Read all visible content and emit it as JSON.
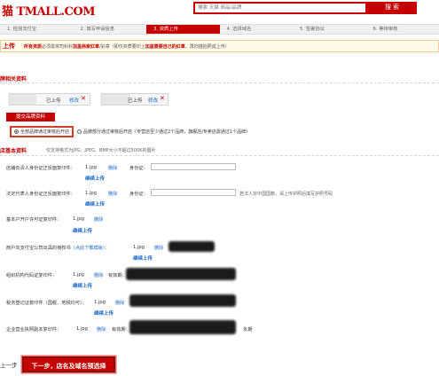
{
  "header": {
    "logo_text": "猫 TMALL.COM",
    "search_placeholder": "搜索 天猫 商品/品牌",
    "search_button": "搜 索"
  },
  "steps": [
    {
      "label": "1. 检测支付宝"
    },
    {
      "label": "2. 填写申请信息"
    },
    {
      "label": "3. 资质上传"
    },
    {
      "label": "4. 选择域名"
    },
    {
      "label": "5. 签署协议"
    },
    {
      "label": "6. 等待审核"
    }
  ],
  "notice": {
    "title": "上传",
    "prefix": "所有资质",
    "mid1": "必须需将司科科",
    "highlight1": "加盖商家红章",
    "mid2": "/彩章（即仅资质要印上",
    "highlight2": "加盖需要自己的红章",
    "suffix": "，再扫描拍照成上传）"
  },
  "brand_section": {
    "title": "牌相关资料",
    "brand1": {
      "status": "已上传",
      "action": "修改"
    },
    "brand2": {
      "status": "已上传",
      "action": "修改"
    },
    "add_button": "提交品牌资料",
    "option1": "全部品牌通过审核后开店",
    "option2": "品牌部分通过审核后开店（专营店至少通过2个品牌，旗舰店/专卖店需通过1个品牌）"
  },
  "basic_section": {
    "title": "店基本资料",
    "format_hint": "仅支持格式为JPG、JPEG、BMP大小不超过500K的图片"
  },
  "fields": {
    "f1": {
      "label": "店铺负责人身份证正反面复印件：",
      "file": "1.jpg",
      "del": "删除",
      "id_label": "身份证：",
      "upload": "继续上传"
    },
    "f2": {
      "label": "法定代表人身份证正反面复印件：",
      "file": "1.jpg",
      "del": "删除",
      "id_label": "身份证：",
      "hint": "若法人非中国国籍，请上传护照后填写护照号码",
      "upload": "继续上传"
    },
    "f3": {
      "label": "基本户开户许可证复印件：",
      "file": "1.jpg",
      "del": "删除",
      "upload": "继续上传"
    },
    "f4": {
      "label": "商户向支付宝公司出具的授权书",
      "template": "（点此下载模板）",
      "colon": "：",
      "file": "1.jpg",
      "del": "删除",
      "upload": "继续上传"
    },
    "f5": {
      "label": "组织机构代码证复印件：",
      "file": "1.jpg",
      "del": "删除",
      "valid": "有效期：",
      "upload": "继续上传"
    },
    "f6": {
      "label": "税务登记证复印件",
      "note": "（国税、地税均可）",
      "colon": "：",
      "file": "1.jpg",
      "del": "删除",
      "upload": "继续上传"
    },
    "f7": {
      "label": "企业营业执照副本复印件：",
      "file": "1.jpg",
      "del": "删除",
      "valid": "有效期：",
      "perm": "永期"
    }
  },
  "footer": {
    "prev": "上一步",
    "next": "下一步，店名及域名预选择"
  },
  "colors": {
    "accent": "#c40000",
    "link": "#1a66cc"
  }
}
